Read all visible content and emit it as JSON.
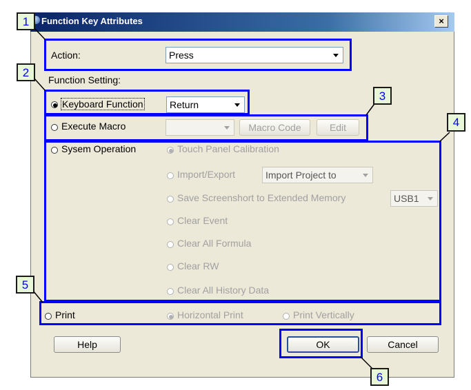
{
  "window": {
    "title": "Function Key Attributes",
    "close_glyph": "×",
    "icon": "app-icon"
  },
  "action": {
    "label": "Action:",
    "selected": "Press"
  },
  "function_setting_label": "Function Setting:",
  "keyboard_function": {
    "label": "Keyboard Function",
    "selected": true,
    "key_selected": "Return"
  },
  "execute_macro": {
    "label": "Execute Macro",
    "selected": false,
    "macro_selected": "",
    "macro_code_button": "Macro Code",
    "edit_button": "Edit"
  },
  "system_operation": {
    "label": "Sysem Operation",
    "selected": false,
    "options": {
      "touch_panel": "Touch Panel Calibration",
      "import_export": "Import/Export",
      "import_select": "Import Project to",
      "save_screenshot": "Save Screenshort to Extended Memory",
      "save_select": "USB1",
      "clear_event": "Clear Event",
      "clear_formula": "Clear All Formula",
      "clear_rw": "Clear RW",
      "clear_history": "Clear All History Data"
    }
  },
  "print": {
    "label": "Print",
    "selected": false,
    "horizontal": "Horizontal Print",
    "vertical": "Print Vertically"
  },
  "buttons": {
    "help": "Help",
    "ok": "OK",
    "cancel": "Cancel"
  },
  "callouts": [
    "1",
    "2",
    "3",
    "4",
    "5",
    "6"
  ],
  "colors": {
    "highlight": "#0000ff",
    "callout_bg": "#e7f7d8",
    "callout_text": "#0000ff",
    "title_bar": "#0a246a"
  }
}
